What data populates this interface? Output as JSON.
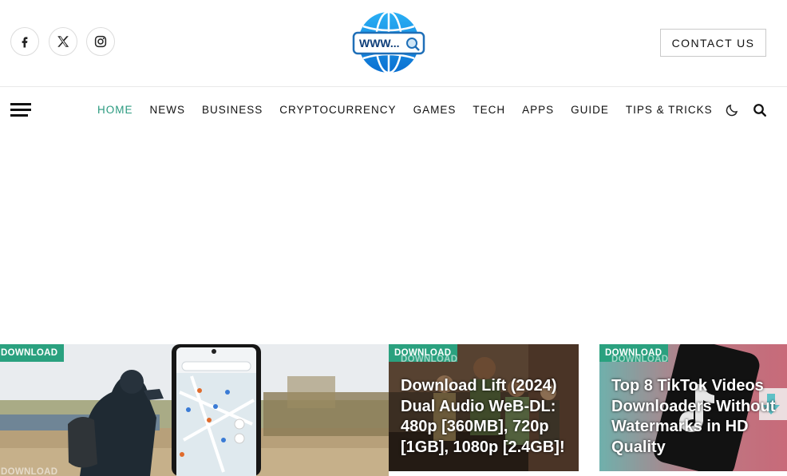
{
  "header": {
    "social": [
      "facebook-icon",
      "x-icon",
      "instagram-icon"
    ],
    "logo_text": "WWW...",
    "contact_label": "CONTACT US"
  },
  "nav": {
    "items": [
      {
        "label": "HOME",
        "active": true
      },
      {
        "label": "NEWS"
      },
      {
        "label": "BUSINESS"
      },
      {
        "label": "CRYPTOCURRENCY"
      },
      {
        "label": "GAMES"
      },
      {
        "label": "TECH"
      },
      {
        "label": "APPS"
      },
      {
        "label": "GUIDE"
      },
      {
        "label": "TIPS & TRICKS"
      }
    ],
    "accent_color": "#2a9a7f"
  },
  "featured": [
    {
      "category": "DOWNLOAD",
      "title": ""
    },
    {
      "category": "DOWNLOAD",
      "title": "Download Lift (2024) Dual Audio WeB-DL: 480p [360MB], 720p [1GB], 1080p [2.4GB]!"
    },
    {
      "category": "DOWNLOAD",
      "title": "Top 8 TikTok Videos Downloaders Without Watermarks in HD Quality"
    }
  ],
  "badge_color": "#2aa17f"
}
